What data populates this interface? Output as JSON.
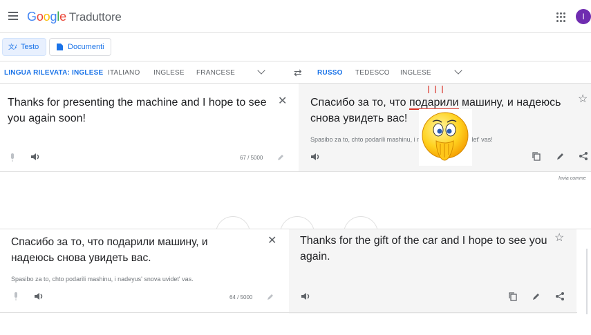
{
  "header": {
    "logo_parts": [
      "G",
      "o",
      "o",
      "g",
      "l",
      "e"
    ],
    "product": "Traduttore",
    "avatar_letter": "I"
  },
  "modes": {
    "text_label": "Testo",
    "documents_label": "Documenti"
  },
  "source_langs": {
    "detected": "LINGUA RILEVATA: INGLESE",
    "l1": "ITALIANO",
    "l2": "INGLESE",
    "l3": "FRANCESE"
  },
  "target_langs": {
    "l1": "RUSSO",
    "l2": "TEDESCO",
    "l3": "INGLESE"
  },
  "top": {
    "source_text": "Thanks for presenting the machine and I hope to see you again soon!",
    "counter": "67 / 5000",
    "target_text_before": "Спасибо за то, что ",
    "target_text_highlight": "подарили",
    "target_text_after": " машину, и надеюсь снова увидеть вас!",
    "transliteration": "Spasibo za to, chto podarili mashinu, i nadeyus' snova uvidet' vas!",
    "feedback": "Invia comme"
  },
  "bottom": {
    "source_text": "Спасибо за то, что подарили машину, и надеюсь снова увидеть вас.",
    "transliteration": "Spasibo za to, chto podarili mashinu, i nadeyus' snova uvidet' vas.",
    "counter": "64 / 5000",
    "target_text": "Thanks for the gift of the car and I hope to see you again."
  },
  "colors": {
    "accent": "#1a73e8",
    "underline": "#d93025",
    "avatar": "#6f2cb0"
  }
}
